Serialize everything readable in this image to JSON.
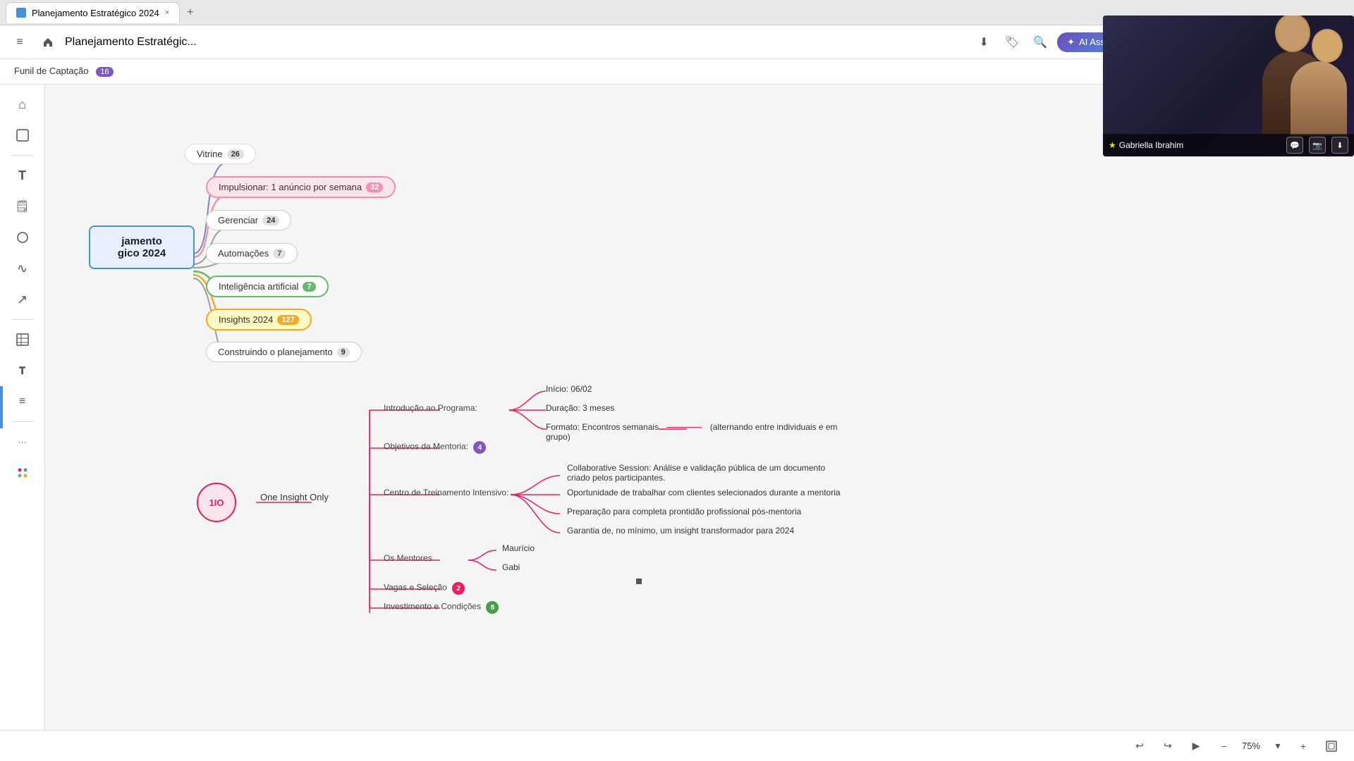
{
  "browser": {
    "tab_title": "Planejamento Estratégico 2024",
    "tab_close": "×",
    "tab_add": "+"
  },
  "toolbar": {
    "breadcrumb": "Planejamento Estratégic...",
    "ai_button": "AI Assistant",
    "second_tab": "Funil de Captação",
    "second_tab_badge": "16"
  },
  "mindmap": {
    "central_node": "jamento\ngico 2024",
    "nodes": [
      {
        "id": "vitrine",
        "label": "Vitrine",
        "badge": "26"
      },
      {
        "id": "impulsionar",
        "label": "Impulsionar: 1 anúncio por semana",
        "badge": "32"
      },
      {
        "id": "gerenciar",
        "label": "Gerenciar",
        "badge": "24"
      },
      {
        "id": "automacoes",
        "label": "Automações",
        "badge": "7"
      },
      {
        "id": "ia",
        "label": "Inteligência artificial",
        "badge": "7"
      },
      {
        "id": "insights",
        "label": "Insights 2024",
        "badge": "127"
      },
      {
        "id": "construindo",
        "label": "Construindo o planejamento",
        "badge": "9"
      }
    ],
    "circle_node": "1IO",
    "one_insight_label": "One Insight Only",
    "branches": [
      {
        "id": "introducao",
        "label": "Introdução ao Programa:"
      },
      {
        "id": "objetivos",
        "label": "Objetivos da Mentoria:",
        "badge": "4"
      },
      {
        "id": "centro",
        "label": "Centro de Treinamento Intensivo:"
      },
      {
        "id": "mentores",
        "label": "Os Mentores"
      },
      {
        "id": "vagas",
        "label": "Vagas e Seleção",
        "badge": "2"
      },
      {
        "id": "investimento",
        "label": "Investimento e Condições",
        "badge": "8"
      }
    ],
    "details": [
      {
        "id": "inicio",
        "label": "Início: 06/02"
      },
      {
        "id": "duracao",
        "label": "Duração: 3 meses"
      },
      {
        "id": "formato",
        "label": "Formato: Encontros semanais",
        "extra": "(alternando entre individuais e em grupo)"
      },
      {
        "id": "collaborative",
        "label": "Collaborative Session: Análise e validação pública de um documento criado pelos participantes."
      },
      {
        "id": "oportunidade",
        "label": "Oportunidade de trabalhar com clientes selecionados durante a mentoria"
      },
      {
        "id": "preparacao",
        "label": "Preparação para completa prontidão profissional pós-mentoria"
      },
      {
        "id": "garantia",
        "label": "Garantia de, no mínimo, um insight transformador para 2024"
      },
      {
        "id": "mauricio",
        "label": "Maurício"
      },
      {
        "id": "gabi",
        "label": "Gabi"
      }
    ]
  },
  "video": {
    "speaker_name": "Gabriella Ibrahim",
    "star_icon": "★"
  },
  "bottom": {
    "zoom_value": "75%",
    "undo_label": "↩",
    "redo_label": "↪"
  },
  "sidebar_icons": [
    {
      "id": "home",
      "symbol": "⌂",
      "active": false
    },
    {
      "id": "frame",
      "symbol": "⬚",
      "active": false
    },
    {
      "id": "text",
      "symbol": "T",
      "active": false
    },
    {
      "id": "sticky",
      "symbol": "🗒",
      "active": false
    },
    {
      "id": "shape",
      "symbol": "◯",
      "active": false
    },
    {
      "id": "pen",
      "symbol": "∿",
      "active": false
    },
    {
      "id": "arrow",
      "symbol": "↗",
      "active": false
    },
    {
      "id": "table",
      "symbol": "▦",
      "active": false
    },
    {
      "id": "text2",
      "symbol": "𝐓",
      "active": false
    },
    {
      "id": "list",
      "symbol": "≡",
      "active": false
    },
    {
      "id": "more",
      "symbol": "···",
      "active": false
    },
    {
      "id": "apps",
      "symbol": "⠿",
      "active": false
    }
  ]
}
